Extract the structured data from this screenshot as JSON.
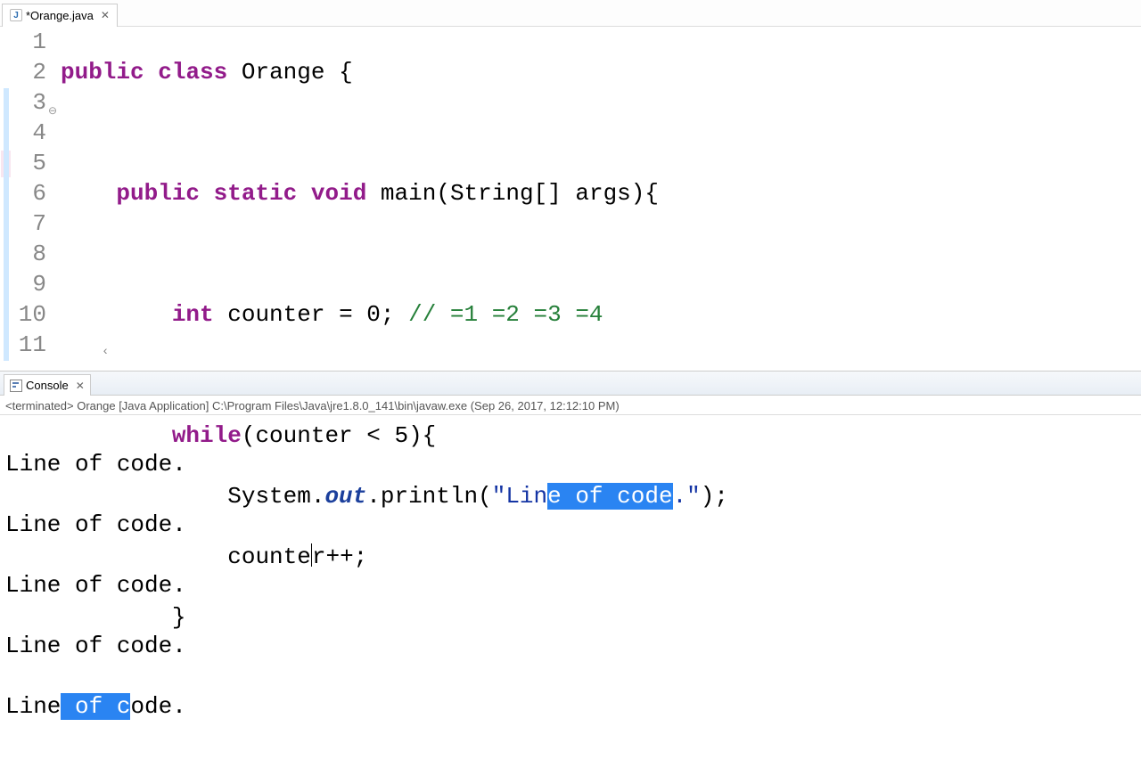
{
  "editor": {
    "tab": {
      "icon_letter": "J",
      "title": "*Orange.java"
    },
    "lines": {
      "1": {
        "num": "1"
      },
      "2": {
        "num": "2"
      },
      "3": {
        "num": "3"
      },
      "4": {
        "num": "4"
      },
      "5": {
        "num": "5"
      },
      "6": {
        "num": "6"
      },
      "7": {
        "num": "7"
      },
      "8": {
        "num": "8"
      },
      "9": {
        "num": "9"
      },
      "10": {
        "num": "10"
      },
      "11": {
        "num": "11"
      }
    },
    "code": {
      "l1": {
        "kw1": "public",
        "kw2": "class",
        "name": "Orange",
        "brace": "{"
      },
      "l3": {
        "kw1": "public",
        "kw2": "static",
        "kw3": "void",
        "fn": "main",
        "sig_open": "(String[] args){"
      },
      "l5": {
        "kw": "int",
        "decl": "counter = 0;",
        "cmt": "// =1 =2 =3 =4"
      },
      "l7": {
        "kw": "while",
        "cond": "(counter < 5){"
      },
      "l8": {
        "sys": "System.",
        "out": "out",
        "call_a": ".println(",
        "q1": "\"",
        "pre": "Lin",
        "sel": "e of code",
        "post": ".",
        "q2": "\"",
        "tail": ");"
      },
      "l9": {
        "a": "counte",
        "b": "r++;"
      },
      "l10": {
        "brace": "}"
      }
    }
  },
  "console": {
    "tab_label": "Console",
    "status": "<terminated> Orange [Java Application] C:\\Program Files\\Java\\jre1.8.0_141\\bin\\javaw.exe (Sep 26, 2017, 12:12:10 PM)",
    "lines": {
      "0": "Line of code.",
      "1": "Line of code.",
      "2": "Line of code.",
      "3": "Line of code.",
      "4": {
        "a": "Line",
        "sel": " of c",
        "b": "ode."
      }
    }
  }
}
